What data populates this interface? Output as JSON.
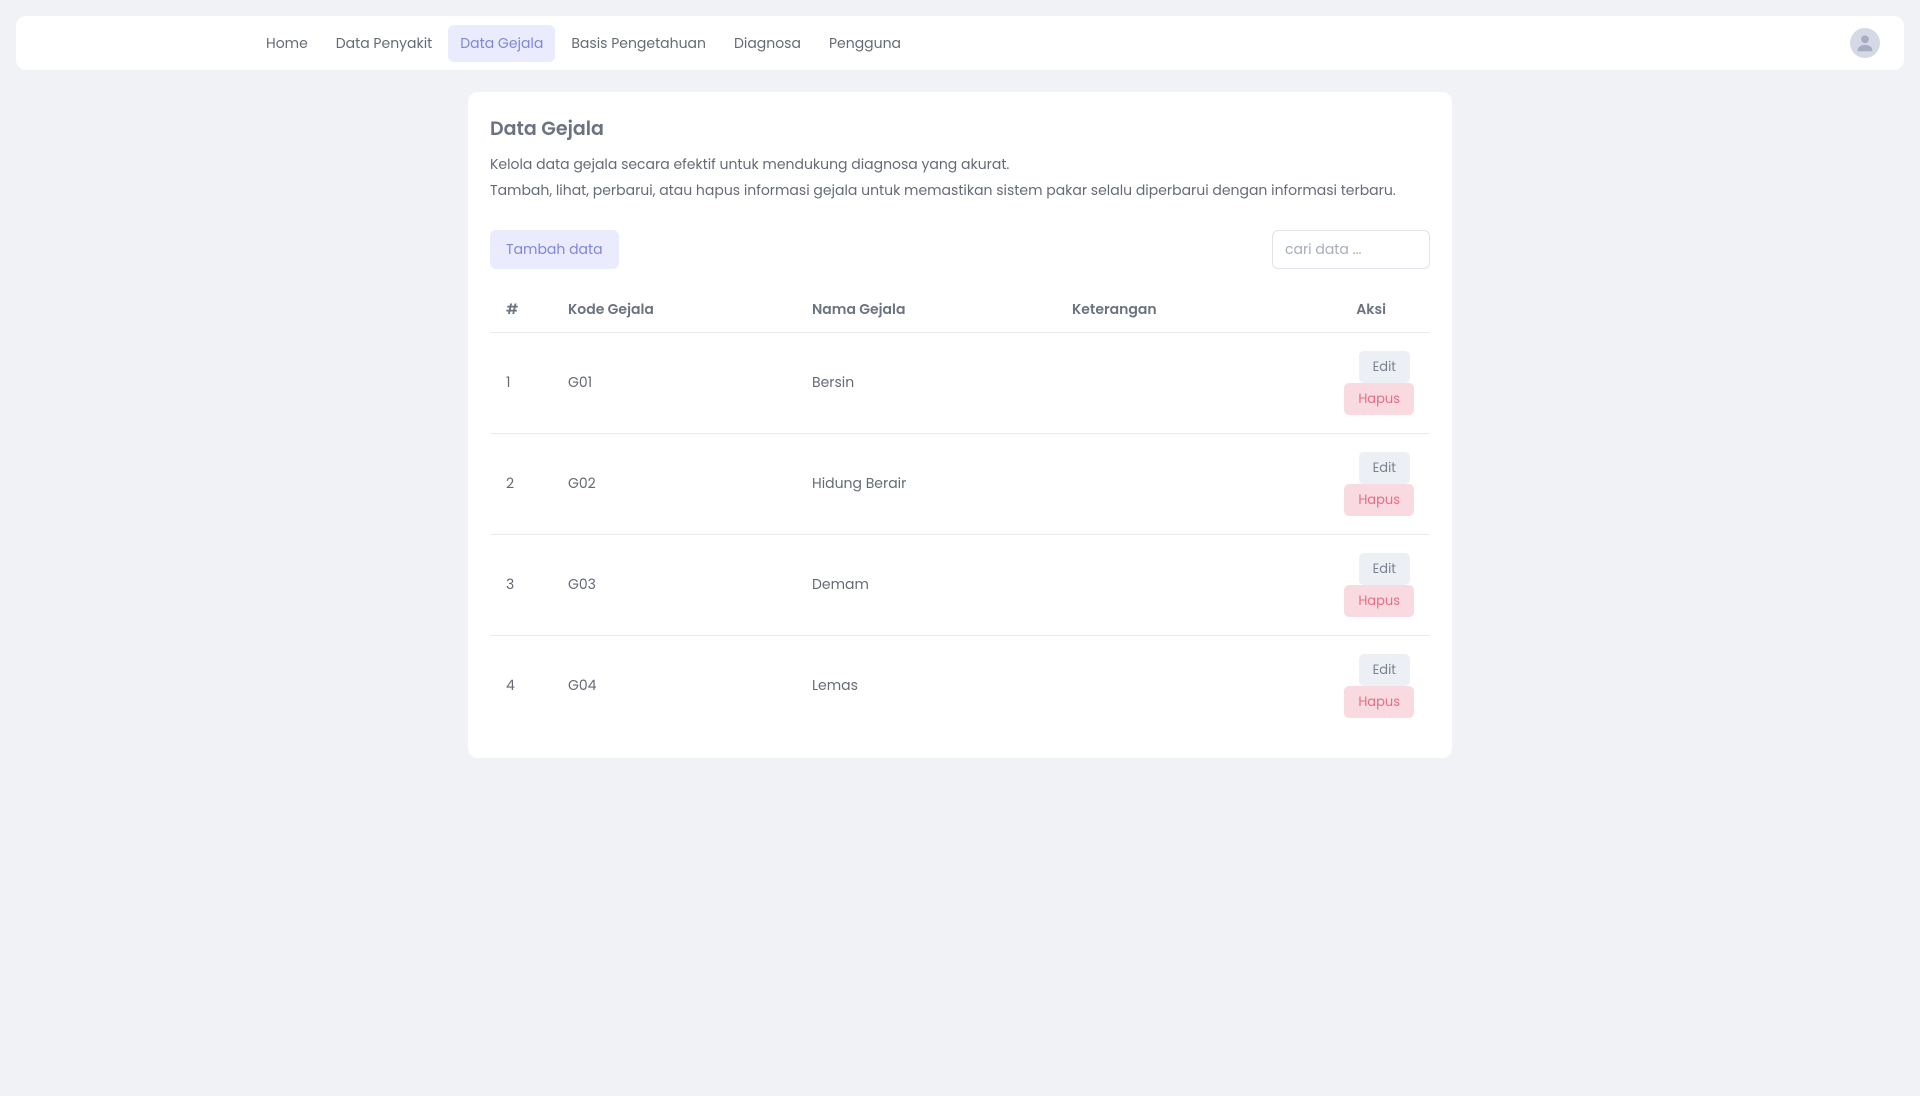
{
  "nav": {
    "items": [
      {
        "label": "Home",
        "active": false
      },
      {
        "label": "Data Penyakit",
        "active": false
      },
      {
        "label": "Data Gejala",
        "active": true
      },
      {
        "label": "Basis Pengetahuan",
        "active": false
      },
      {
        "label": "Diagnosa",
        "active": false
      },
      {
        "label": "Pengguna",
        "active": false
      }
    ]
  },
  "page": {
    "title": "Data Gejala",
    "desc_line1": "Kelola data gejala secara efektif untuk mendukung diagnosa yang akurat.",
    "desc_line2": "Tambah, lihat, perbarui, atau hapus informasi gejala untuk memastikan sistem pakar selalu diperbarui dengan informasi terbaru."
  },
  "toolbar": {
    "add_label": "Tambah data",
    "search_placeholder": "cari data ..."
  },
  "table": {
    "headers": {
      "num": "#",
      "kode": "Kode Gejala",
      "nama": "Nama Gejala",
      "ket": "Keterangan",
      "aksi": "Aksi"
    },
    "action_labels": {
      "edit": "Edit",
      "delete": "Hapus"
    },
    "rows": [
      {
        "num": "1",
        "kode": "G01",
        "nama": "Bersin",
        "ket": ""
      },
      {
        "num": "2",
        "kode": "G02",
        "nama": "Hidung Berair",
        "ket": ""
      },
      {
        "num": "3",
        "kode": "G03",
        "nama": "Demam",
        "ket": ""
      },
      {
        "num": "4",
        "kode": "G04",
        "nama": "Lemas",
        "ket": ""
      }
    ]
  }
}
